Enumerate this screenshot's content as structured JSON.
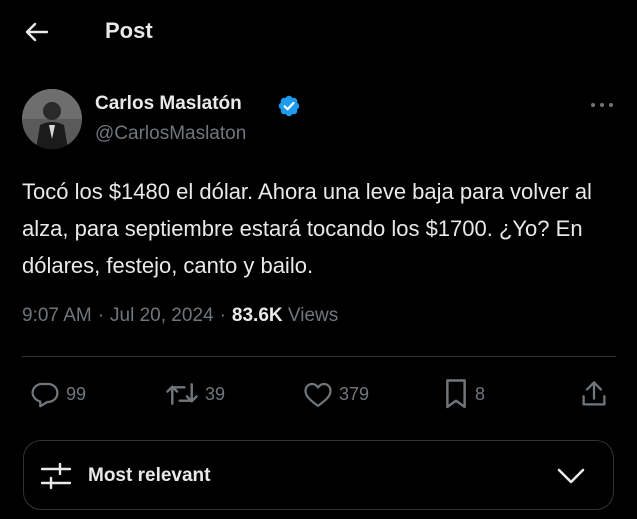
{
  "header": {
    "title": "Post"
  },
  "author": {
    "name": "Carlos Maslatón",
    "handle": "@CarlosMaslaton",
    "verified": true
  },
  "tweet": {
    "text": "Tocó los $1480 el dólar. Ahora una leve baja para volver al alza, para septiembre estará tocando los $1700. ¿Yo? En dólares, festejo, canto y bailo.",
    "time": "9:07 AM",
    "date": "Jul 20, 2024",
    "views_count": "83.6K",
    "views_label": "Views"
  },
  "actions": {
    "replies": "99",
    "reposts": "39",
    "likes": "379",
    "bookmarks": "8"
  },
  "sort": {
    "label": "Most relevant"
  },
  "colors": {
    "background": "#000000",
    "text": "#e7e9ea",
    "muted": "#71767b",
    "border": "#2f3336",
    "verified": "#1d9bf0"
  },
  "icons": [
    "back-arrow-icon",
    "verified-badge-icon",
    "more-icon",
    "reply-icon",
    "repost-icon",
    "like-icon",
    "bookmark-icon",
    "share-icon",
    "sort-sliders-icon",
    "chevron-down-icon"
  ]
}
